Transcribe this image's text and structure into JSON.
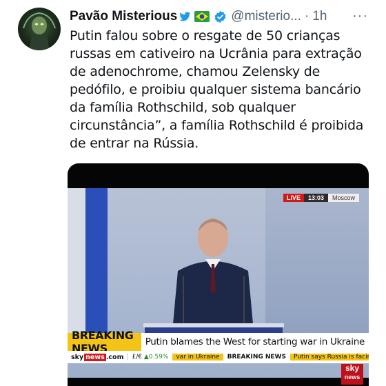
{
  "author": {
    "display_name": "Pavão Misterious",
    "handle": "@misterio...",
    "separator": "·",
    "time": "1h",
    "more": "···"
  },
  "tweet": {
    "text": "Putin falou sobre o resgate de 50 crianças russas em cativeiro na Ucrânia para extração de adenochrome, chamou Zelensky de pedófilo, e proibiu qualquer sistema bancário da família Rothschild, sob qualquer circunstância”, a família Rothschild é proibida de entrar na Rússia."
  },
  "video": {
    "live_label": "LIVE",
    "clock": "13:03",
    "city": "Moscow",
    "breaking_label": "BREAKING NEWS",
    "breaking_headline": "Putin blames the West for starting war in Ukraine",
    "ticker": {
      "brand_sky": "sky",
      "brand_news": "news",
      "brand_com": ".com",
      "fx_pair": "£/€",
      "fx_change": "▲0.59%",
      "item1": "var in Ukraine",
      "item2": "BREAKING NEWS",
      "item3": "Putin says Russia is facing a \"v"
    },
    "corner_logo_top": "sky",
    "corner_logo_bottom": "news"
  },
  "colors": {
    "twitter_blue": "#1d9bf0",
    "breaking_yellow": "#f3c315",
    "live_red": "#d11a1a"
  },
  "icons": [
    "bird-icon",
    "brazil-flag-icon",
    "verified-icon",
    "more-icon"
  ]
}
